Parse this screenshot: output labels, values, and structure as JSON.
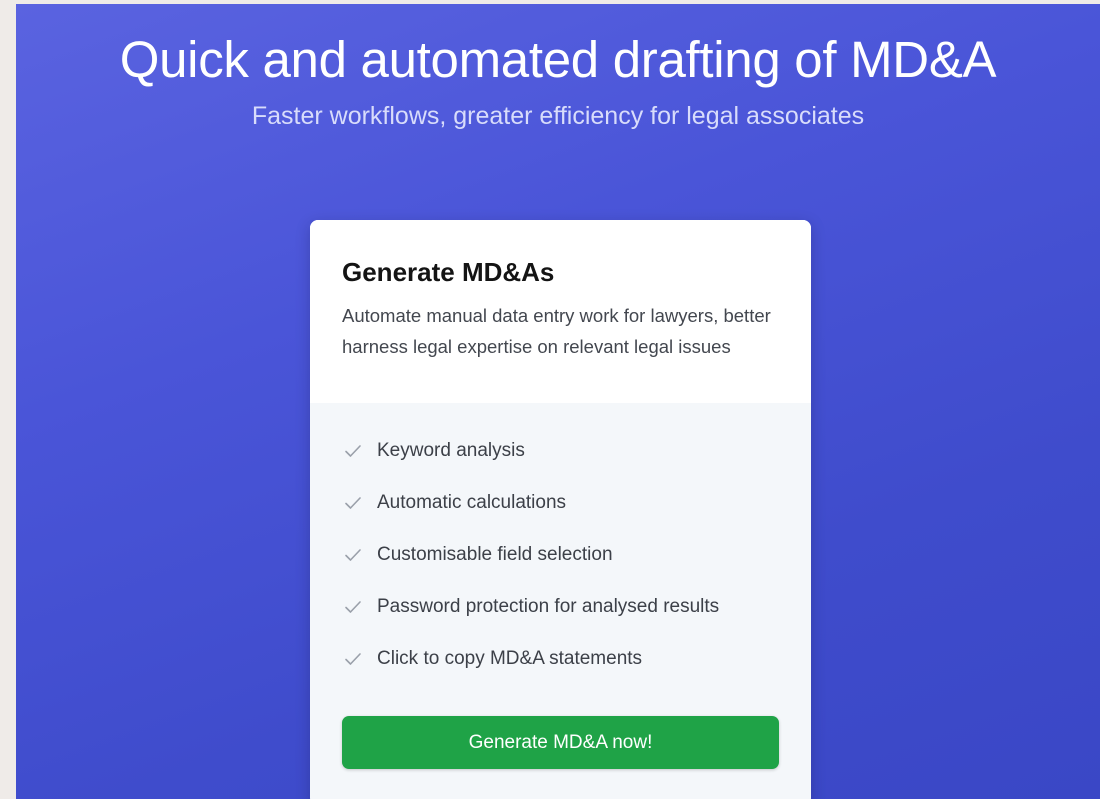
{
  "hero": {
    "title": "Quick and automated drafting of MD&A",
    "subtitle": "Faster workflows, greater efficiency for legal associates"
  },
  "card": {
    "title": "Generate MD&As",
    "description": "Automate manual data entry work for lawyers, better harness legal expertise on relevant legal issues",
    "features": [
      {
        "icon": "check-icon",
        "label": "Keyword analysis"
      },
      {
        "icon": "check-icon",
        "label": "Automatic calculations"
      },
      {
        "icon": "check-icon",
        "label": "Customisable field selection"
      },
      {
        "icon": "check-icon",
        "label": "Password protection for analysed results"
      },
      {
        "icon": "check-icon",
        "label": "Click to copy MD&A statements"
      }
    ],
    "cta_label": "Generate MD&A now!"
  },
  "colors": {
    "background_gradient_start": "#5a63e0",
    "background_gradient_end": "#3a47c6",
    "cta_green": "#1fa347",
    "card_lower_bg": "#f4f7fa"
  }
}
